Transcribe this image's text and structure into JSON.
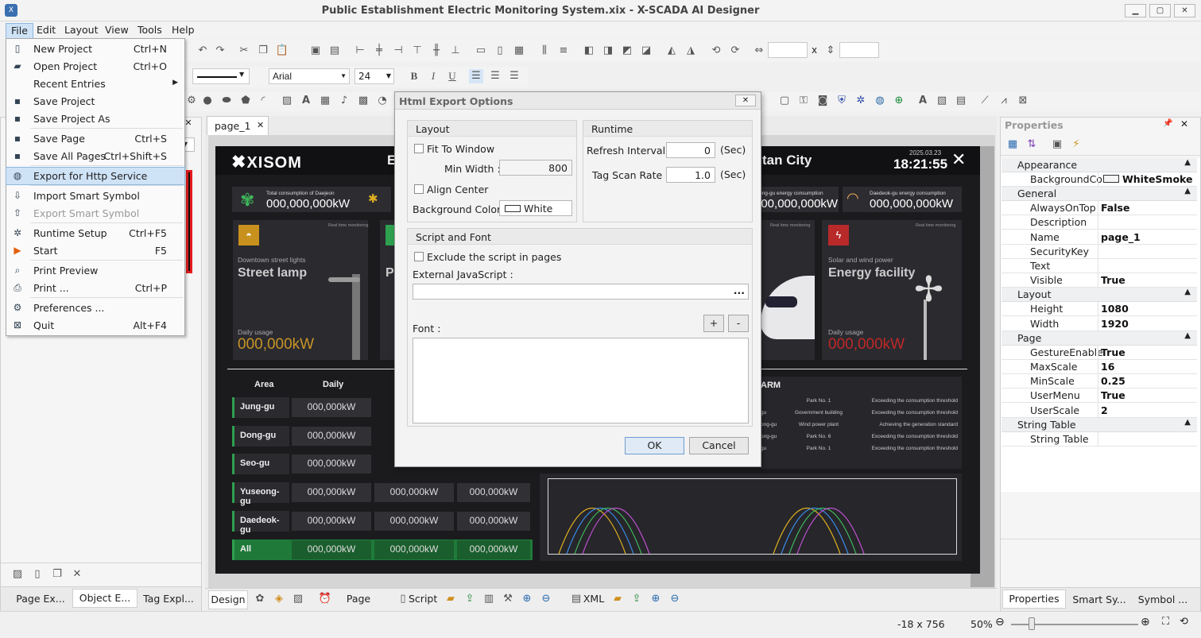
{
  "window": {
    "title": "Public Establishment Electric Monitoring System.xix - X-SCADA AI Designer"
  },
  "menubar": [
    "File",
    "Edit",
    "Layout",
    "View",
    "Tools",
    "Help"
  ],
  "file_menu": [
    {
      "label": "New Project",
      "shortcut": "Ctrl+N",
      "icon": "new-file-icon"
    },
    {
      "label": "Open Project",
      "shortcut": "Ctrl+O",
      "icon": "open-folder-icon"
    },
    {
      "label": "Recent Entries",
      "shortcut": "",
      "icon": "",
      "submenu": true
    },
    {
      "label": "Save Project",
      "shortcut": "",
      "icon": "save-icon"
    },
    {
      "label": "Save Project As",
      "shortcut": "",
      "icon": "save-as-icon"
    },
    {
      "label": "Save Page",
      "shortcut": "Ctrl+S",
      "icon": "save-icon"
    },
    {
      "label": "Save All Pages",
      "shortcut": "Ctrl+Shift+S",
      "icon": "save-all-icon"
    },
    {
      "label": "Export for Http Service",
      "shortcut": "",
      "icon": "globe-export-icon",
      "highlighted": true
    },
    {
      "label": "Import Smart Symbol",
      "shortcut": "",
      "icon": "import-icon"
    },
    {
      "label": "Export Smart Symbol",
      "shortcut": "",
      "icon": "export-icon",
      "disabled": true
    },
    {
      "label": "Runtime Setup",
      "shortcut": "Ctrl+F5",
      "icon": "runtime-icon"
    },
    {
      "label": "Start",
      "shortcut": "F5",
      "icon": "play-icon"
    },
    {
      "label": "Print Preview",
      "shortcut": "",
      "icon": "print-preview-icon"
    },
    {
      "label": "Print ...",
      "shortcut": "Ctrl+P",
      "icon": "print-icon"
    },
    {
      "label": "Preferences ...",
      "shortcut": "",
      "icon": "gear-icon"
    },
    {
      "label": "Quit",
      "shortcut": "Alt+F4",
      "icon": "close-icon"
    }
  ],
  "font_toolbar": {
    "font": "Arial",
    "size": "24"
  },
  "doc_tab": "page_1",
  "dialog": {
    "title": "Html Export Options",
    "layout_group": "Layout",
    "fit_to_window": "Fit To Window",
    "min_width_label": "Min Width :",
    "min_width": "800",
    "align_center": "Align Center",
    "bg_color_label": "Background Color :",
    "bg_color": "White",
    "runtime_group": "Runtime",
    "refresh_label": "Refresh Interval :",
    "refresh": "0",
    "refresh_unit": "(Sec)",
    "tagscan_label": "Tag Scan Rate :",
    "tagscan": "1.0",
    "tagscan_unit": "(Sec)",
    "script_group": "Script and Font",
    "exclude_script": "Exclude the script in pages",
    "external_js_label": "External JavaScript :",
    "ellipsis": "...",
    "font_label": "Font :",
    "plus": "+",
    "minus": "-",
    "ok": "OK",
    "cancel": "Cancel"
  },
  "dashboard": {
    "logo": "XISOM",
    "title_left": "E",
    "title_right": "tan City",
    "date": "2025.03.23",
    "time": "18:21:55",
    "stat1_title": "Total consumption of Daejeon",
    "stat1_value": "000,000,000kW",
    "stat3_title": "ong-gu energy consumption",
    "stat3_value": "000,000,000kW",
    "stat4_title": "Daedeok-gu energy consumption",
    "stat4_value": "000,000,000kW",
    "card1_sub": "Downtown street lights",
    "card1_title": "Street lamp",
    "card1_usage_label": "Daily usage",
    "card1_value": "000,000kW",
    "card_rt": "Real time monitoring",
    "card4_sub": "Solar and wind power",
    "card4_title": "Energy facility",
    "card4_usage_label": "Daily usage",
    "card4_value": "000,000kW",
    "table_head": [
      "Area",
      "Daily"
    ],
    "rows": [
      {
        "area": "Jung-gu",
        "vals": [
          "000,000kW"
        ]
      },
      {
        "area": "Dong-gu",
        "vals": [
          "000,000kW"
        ]
      },
      {
        "area": "Seo-gu",
        "vals": [
          "000,000kW"
        ]
      },
      {
        "area": "Yuseong-gu",
        "vals": [
          "000,000kW",
          "000,000kW",
          "000,000kW"
        ]
      },
      {
        "area": "Daedeok-gu",
        "vals": [
          "000,000kW",
          "000,000kW",
          "000,000kW"
        ]
      },
      {
        "area": "All",
        "vals": [
          "000,000kW",
          "000,000kW",
          "000,000kW"
        ]
      }
    ],
    "alarm_title": "ARM",
    "alarms": [
      [
        "",
        "Park No. 1",
        "Exceeding the consumption threshold"
      ],
      [
        "gu",
        "Government building",
        "Exceeding the consumption threshold"
      ],
      [
        "ong-gu",
        "Wind power plant",
        "Achieving the generation standard"
      ],
      [
        "ong-gu",
        "Park No. 6",
        "Exceeding the consumption threshold"
      ],
      [
        "gu",
        "Park No. 1",
        "Exceeding the consumption threshold"
      ]
    ]
  },
  "left_tabs": [
    "Page Ex...",
    "Object E...",
    "Tag Expl..."
  ],
  "bottom_tabs": {
    "design": "Design",
    "alarm": "Page Alarm",
    "script": "Script",
    "xml": "XML"
  },
  "properties": {
    "title": "Properties",
    "groups": [
      {
        "name": "Appearance",
        "rows": [
          [
            "BackgroundColo",
            "WhiteSmoke"
          ]
        ]
      },
      {
        "name": "General",
        "rows": [
          [
            "AlwaysOnTop",
            "False"
          ],
          [
            "Description",
            ""
          ],
          [
            "Name",
            "page_1"
          ],
          [
            "SecurityKey",
            ""
          ],
          [
            "Text",
            ""
          ],
          [
            "Visible",
            "True"
          ]
        ]
      },
      {
        "name": "Layout",
        "rows": [
          [
            "Height",
            "1080"
          ],
          [
            "Width",
            "1920"
          ]
        ]
      },
      {
        "name": "Page",
        "rows": [
          [
            "GestureEnable",
            "True"
          ],
          [
            "MaxScale",
            "16"
          ],
          [
            "MinScale",
            "0.25"
          ],
          [
            "UserMenu",
            "True"
          ],
          [
            "UserScale",
            "2"
          ]
        ]
      },
      {
        "name": "String Table",
        "rows": [
          [
            "String Table",
            ""
          ]
        ]
      }
    ]
  },
  "right_tabs": [
    "Properties",
    "Smart Sy...",
    "Symbol ..."
  ],
  "status": {
    "coords": "-18 x 756",
    "zoom": "50%"
  },
  "colors": {
    "accent": "#2ea04f",
    "dark_bg": "#1b1b1e",
    "highlight": "#cfe3f7"
  }
}
